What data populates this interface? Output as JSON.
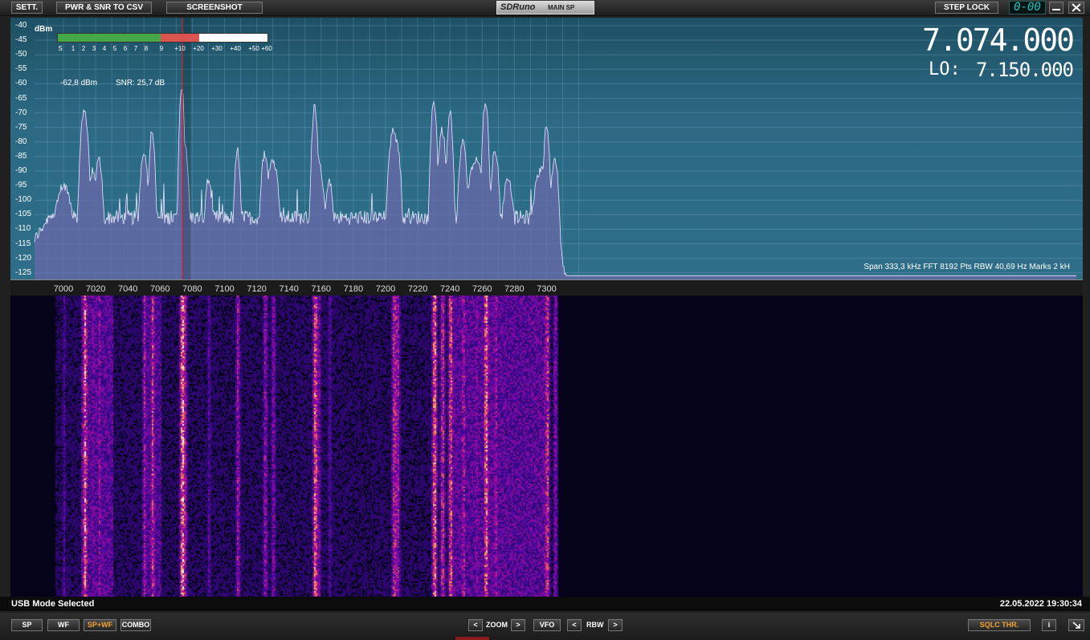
{
  "topbar": {
    "sett_label": "SETT.",
    "pwr_snr_label": "PWR & SNR TO CSV",
    "screenshot_label": "SCREENSHOT",
    "brand": "SDRuno",
    "window_name": "MAIN SP",
    "step_lock_label": "STEP LOCK",
    "vfo_readout": "0-00",
    "minimize_icon": "minimize-icon",
    "close_icon": "close-icon"
  },
  "spectrum": {
    "unit": "dBm",
    "y_ticks": [
      "-40",
      "-45",
      "-50",
      "-55",
      "-60",
      "-65",
      "-70",
      "-75",
      "-80",
      "-85",
      "-90",
      "-95",
      "-100",
      "-105",
      "-110",
      "-115",
      "-120",
      "-125"
    ],
    "level_readout": "-62,8 dBm",
    "snr_readout": "SNR: 25,7 dB",
    "frequency": "7.074.000",
    "lo_label": "LO:",
    "lo_value": "7.150.000",
    "span_info": "Span 333,3 kHz   FFT 8192 Pts   RBW 40,69 Hz   Marks 2 kH",
    "smeter_scale": [
      "S",
      "1",
      "2",
      "3",
      "4",
      "5",
      "6",
      "7",
      "8",
      "9",
      "+10",
      "+20",
      "+30",
      "+40",
      "+50",
      "+60"
    ],
    "smeter_level_s": 9,
    "smeter_level_over": 20
  },
  "freq_axis": {
    "labels": [
      "7000",
      "7020",
      "7040",
      "7060",
      "7080",
      "7100",
      "7120",
      "7140",
      "7160",
      "7180",
      "7200",
      "7220",
      "7240",
      "7260",
      "7280",
      "7300"
    ]
  },
  "status": {
    "mode": "USB Mode Selected",
    "datetime": "22.05.2022 19:30:34"
  },
  "bottombar": {
    "sp": "SP",
    "wf": "WF",
    "spwf": "SP+WF",
    "combo": "COMBO",
    "prev": "<",
    "zoom": "ZOOM",
    "next": ">",
    "vfo": "VFO",
    "rbw": "RBW",
    "sqlc": "SQLC THR.",
    "info": "i"
  },
  "colors": {
    "spectrum_bg": "#2c6a84",
    "trace_fill": "#6a6aa8",
    "cursor": "#d02020",
    "accent_orange": "#f0a030"
  }
}
